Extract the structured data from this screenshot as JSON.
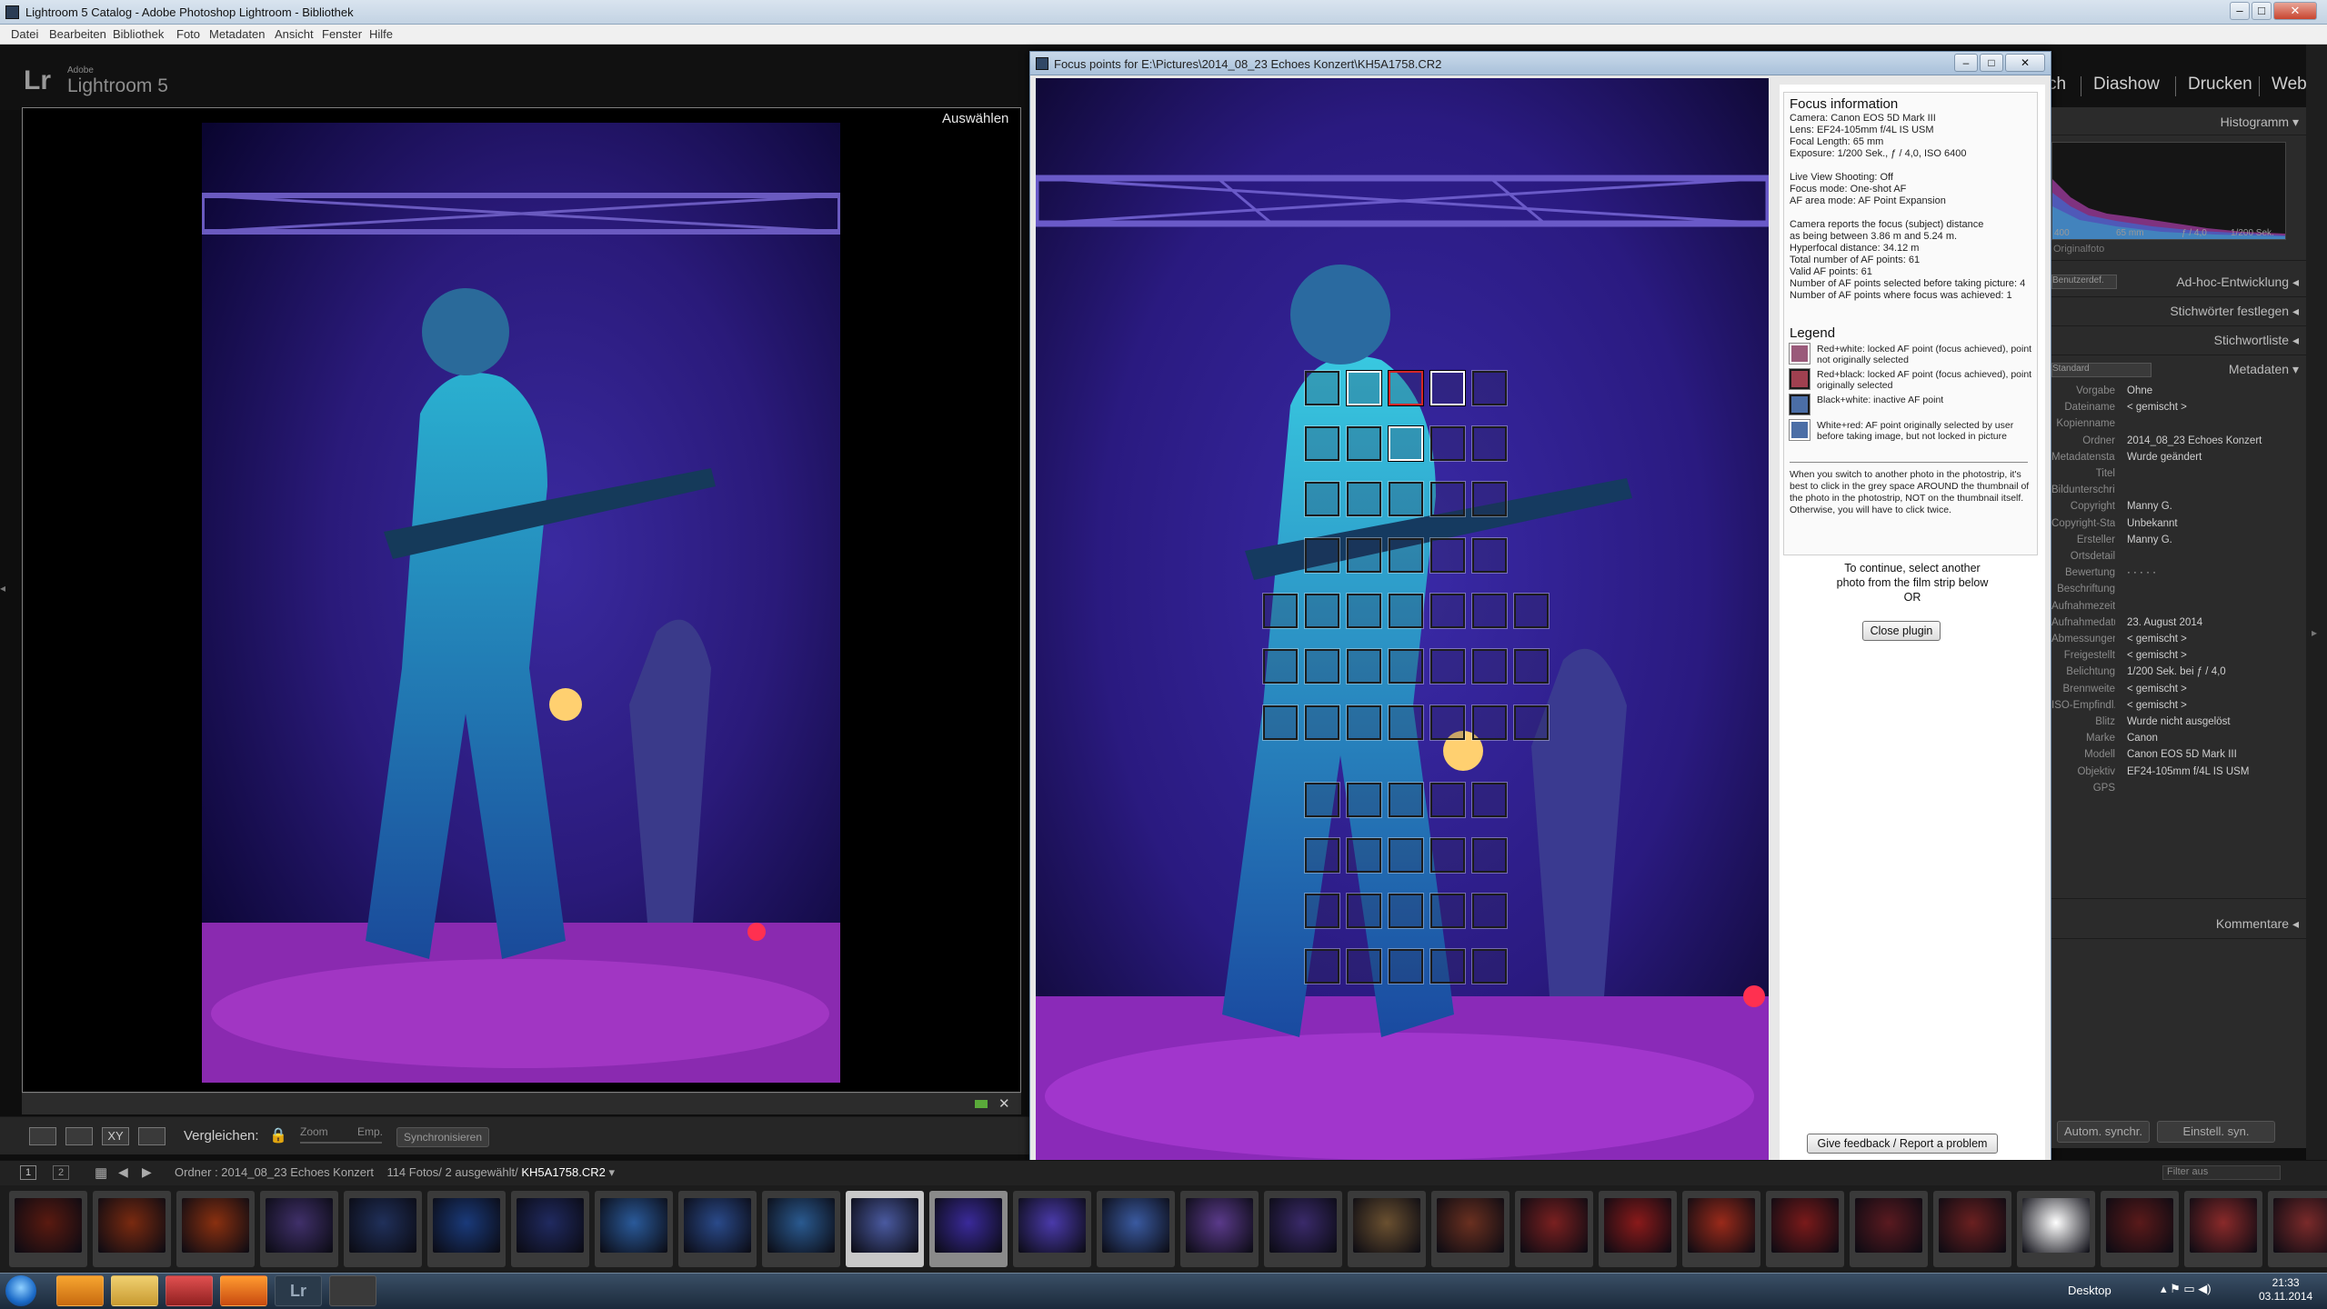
{
  "window": {
    "title": "Lightroom 5 Catalog - Adobe Photoshop Lightroom - Bibliothek",
    "menu": [
      "Datei",
      "Bearbeiten",
      "Bibliothek",
      "Foto",
      "Metadaten",
      "Ansicht",
      "Fenster",
      "Hilfe"
    ]
  },
  "branding": {
    "logo": "Lr",
    "adobe": "Adobe",
    "product": "Lightroom 5"
  },
  "modules": [
    "ch",
    "Diashow",
    "Drucken",
    "Web"
  ],
  "compare": {
    "selected_label": "Auswählen",
    "toolbar": {
      "compare_label": "Vergleichen:",
      "zoom_label": "Zoom",
      "emp_label": "Emp.",
      "sync_button": "Synchronisieren"
    }
  },
  "plugin": {
    "title": "Focus points for E:\\Pictures\\2014_08_23 Echoes Konzert\\KH5A1758.CR2",
    "info_heading": "Focus information",
    "info_lines": [
      "Camera: Canon EOS 5D Mark III",
      "Lens: EF24-105mm f/4L IS USM",
      "Focal Length: 65 mm",
      "Exposure: 1/200 Sek., ƒ / 4,0, ISO 6400",
      "",
      "Live View Shooting: Off",
      "Focus mode: One-shot AF",
      "AF area mode: AF Point Expansion",
      "",
      "Camera reports the focus (subject) distance",
      "as being between 3.86 m and 5.24 m.",
      "Hyperfocal distance: 34.12 m",
      "Total number of AF points: 61",
      "Valid AF points: 61",
      "Number of AF points selected before taking picture: 4",
      "Number of AF points where focus was achieved: 1"
    ],
    "legend_heading": "Legend",
    "legend": [
      {
        "text": "Red+white: locked AF point (focus achieved), point not originally selected",
        "border": "#ffffff",
        "fill": "#9a5a7a"
      },
      {
        "text": "Red+black: locked AF point (focus achieved), point originally selected",
        "border": "#1a1a1a",
        "fill": "#a04050"
      },
      {
        "text": "Black+white: inactive AF point",
        "border": "#1a1a1a",
        "fill": "#4b6ea6"
      },
      {
        "text": "White+red: AF point originally selected by user before taking image, but not locked in picture",
        "border": "#ffffff",
        "fill": "#4b6ea6"
      }
    ],
    "hint": "When you switch to another photo in the photostrip, it's best to click in the grey space AROUND the thumbnail of the photo in the photostrip, NOT on the thumbnail itself. Otherwise, you will have to click twice.",
    "continue_lines": [
      "To continue, select another",
      "photo from the film strip below",
      "OR"
    ],
    "close_button": "Close plugin",
    "feedback_button": "Give feedback / Report a problem"
  },
  "right_panel": {
    "histogram": {
      "title": "Histogramm",
      "readout": [
        "400",
        "65 mm",
        "ƒ / 4,0",
        "1/200 Sek."
      ],
      "original": "Originalfoto"
    },
    "sections": [
      "Ad-hoc-Entwicklung",
      "Stichwörter festlegen",
      "Stichwortliste",
      "Metadaten",
      "Kommentare"
    ],
    "qd_label": "Benutzerdef.",
    "preset_label": "Standard",
    "metadata": [
      {
        "label": "Vorgabe",
        "value": "Ohne"
      },
      {
        "label": "Dateiname",
        "value": "< gemischt >"
      },
      {
        "label": "Kopienname",
        "value": ""
      },
      {
        "label": "Ordner",
        "value": "2014_08_23 Echoes Konzert"
      },
      {
        "label": "Metadatenstatus",
        "value": "Wurde geändert"
      },
      {
        "label": "Titel",
        "value": ""
      },
      {
        "label": "Bildunterschrift",
        "value": ""
      },
      {
        "label": "Copyright",
        "value": "Manny G."
      },
      {
        "label": "Copyright-Status",
        "value": "Unbekannt"
      },
      {
        "label": "Ersteller",
        "value": "Manny G."
      },
      {
        "label": "Ortsdetail",
        "value": ""
      },
      {
        "label": "Bewertung",
        "value": "·  ·  ·  ·  ·"
      },
      {
        "label": "Beschriftung",
        "value": ""
      },
      {
        "label": "Aufnahmezeit",
        "value": ""
      },
      {
        "label": "Aufnahmedatum",
        "value": "23. August 2014"
      },
      {
        "label": "Abmessungen",
        "value": "< gemischt >"
      },
      {
        "label": "Freigestellt",
        "value": "< gemischt >"
      },
      {
        "label": "Belichtung",
        "value": "1/200 Sek. bei ƒ / 4,0"
      },
      {
        "label": "Brennweite",
        "value": "< gemischt >"
      },
      {
        "label": "ISO-Empfindl.",
        "value": "< gemischt >"
      },
      {
        "label": "Blitz",
        "value": "Wurde nicht ausgelöst"
      },
      {
        "label": "Marke",
        "value": "Canon"
      },
      {
        "label": "Modell",
        "value": "Canon EOS 5D Mark III"
      },
      {
        "label": "Objektiv",
        "value": "EF24-105mm f/4L IS USM"
      },
      {
        "label": "GPS",
        "value": ""
      }
    ],
    "sync_meta_button": "Autom. synchr.",
    "sync_settings_button": "Einstell. syn."
  },
  "filmstrip": {
    "pages": [
      "1",
      "2"
    ],
    "folder_label": "Ordner : 2014_08_23 Echoes Konzert",
    "count": "114 Fotos/ 2 ausgewählt/",
    "current_file": "KH5A1758.CR2",
    "filter_label": "Filter aus",
    "thumb_colors": [
      "#5a1a10",
      "#7a2a10",
      "#8a3010",
      "#40306a",
      "#20305a",
      "#1a3a7a",
      "#202a60",
      "#2a5a9a",
      "#2a4a8a",
      "#2a5a90",
      "#4a5aa0",
      "#3a2a9a",
      "#4a3aaa",
      "#3a5aa0",
      "#5a3a8a",
      "#3a2a6a",
      "#6a5030",
      "#6a3020",
      "#7a2020",
      "#8a1a1a",
      "#9a2a1a",
      "#7a1a1a",
      "#5a1a20",
      "#6a2020",
      "#ffffff",
      "#5a1a1a",
      "#8a2a2a",
      "#7a2a2a"
    ]
  },
  "taskbar": {
    "desktop": "Desktop",
    "time": "21:33",
    "date": "03.11.2014"
  }
}
